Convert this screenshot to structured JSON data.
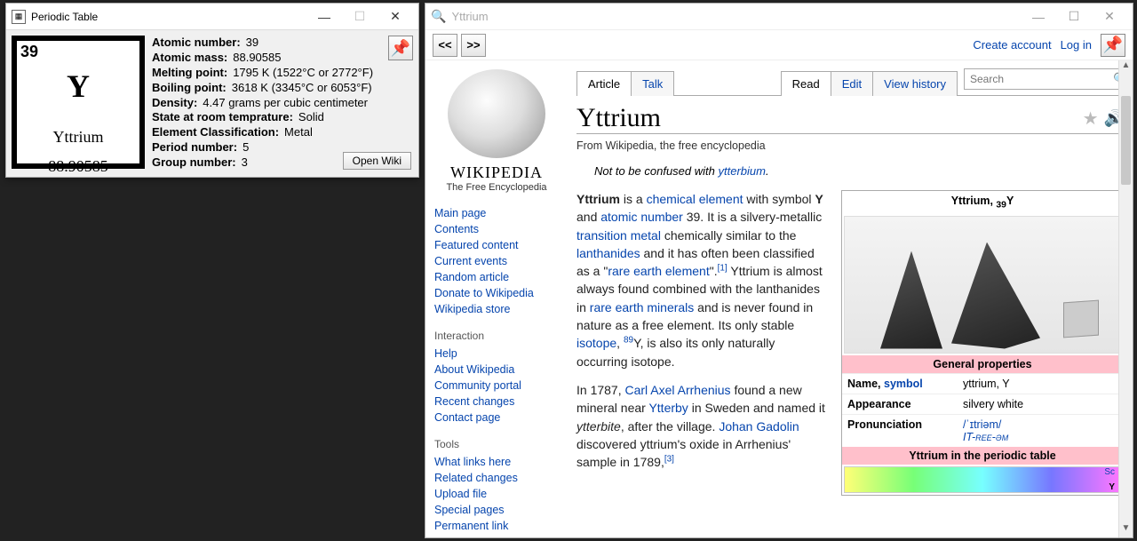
{
  "pt_window": {
    "title": "Periodic Table",
    "tile": {
      "number": "39",
      "symbol": "Y",
      "name": "Yttrium",
      "mass": "88.90585"
    },
    "props": {
      "atomic_number_label": "Atomic number:",
      "atomic_number": "39",
      "atomic_mass_label": "Atomic mass:",
      "atomic_mass": "88.90585",
      "melting_label": "Melting point:",
      "melting": "1795 K (1522°C or 2772°F)",
      "boiling_label": "Boiling point:",
      "boiling": "3618 K (3345°C or 6053°F)",
      "density_label": "Density:",
      "density": "4.47 grams per cubic centimeter",
      "state_label": "State at room temprature:",
      "state": "Solid",
      "class_label": "Element Classification:",
      "class": "Metal",
      "period_label": "Period number:",
      "period": "5",
      "group_label": "Group number:",
      "group": "3"
    },
    "open_wiki": "Open Wiki"
  },
  "wiki_window": {
    "title": "Yttrium",
    "nav_prev": "<<",
    "nav_next": ">>",
    "create_account": "Create account",
    "log_in": "Log in",
    "logo": {
      "word": "WIKIPEDIA",
      "tag": "The Free Encyclopedia"
    },
    "side_nav": {
      "main": [
        "Main page",
        "Contents",
        "Featured content",
        "Current events",
        "Random article",
        "Donate to Wikipedia",
        "Wikipedia store"
      ],
      "interaction_head": "Interaction",
      "interaction": [
        "Help",
        "About Wikipedia",
        "Community portal",
        "Recent changes",
        "Contact page"
      ],
      "tools_head": "Tools",
      "tools": [
        "What links here",
        "Related changes",
        "Upload file",
        "Special pages",
        "Permanent link"
      ]
    },
    "tabs": {
      "article": "Article",
      "talk": "Talk",
      "read": "Read",
      "edit": "Edit",
      "history": "View history"
    },
    "search_placeholder": "Search",
    "article": {
      "heading": "Yttrium",
      "sub": "From Wikipedia, the free encyclopedia",
      "note_prefix": "Not to be confused with ",
      "note_link": "ytterbium",
      "note_suffix": ".",
      "para1_parts": {
        "t1": "Yttrium",
        "t2": " is a ",
        "l1": "chemical element",
        "t3": " with symbol ",
        "b1": "Y",
        "t4": " and ",
        "l2": "atomic number",
        "t5": " 39. It is a silvery-metallic ",
        "l3": "transition metal",
        "t6": " chemically similar to the ",
        "l4": "lanthanides",
        "t7": " and it has often been classified as a \"",
        "l5": "rare earth element",
        "t8": "\".",
        "sup1": "[1]",
        "t9": " Yttrium is almost always found combined with the lanthanides in ",
        "l6": "rare earth minerals",
        "t10": " and is never found in nature as a free element. Its only stable ",
        "l7": "isotope",
        "t11": ", ",
        "sup2": "89",
        "t12": "Y, is also its only naturally occurring isotope."
      },
      "para2_parts": {
        "t1": "In 1787, ",
        "l1": "Carl Axel Arrhenius",
        "t2": " found a new mineral near ",
        "l2": "Ytterby",
        "t3": " in Sweden and named it ",
        "i1": "ytterbite",
        "t4": ", after the village. ",
        "l3": "Johan Gadolin",
        "t5": " discovered yttrium's oxide in Arrhenius' sample in 1789,",
        "sup1": "[3]"
      }
    },
    "infobox": {
      "title_pre": "Yttrium,  ",
      "title_sub": "39",
      "title_sym": "Y",
      "gen_props": "General properties",
      "name_k": "Name, ",
      "name_k_link": "symbol",
      "name_v": "yttrium, Y",
      "appear_k": "Appearance",
      "appear_v": "silvery white",
      "pron_k": "Pronunciation",
      "pron_v1": "/ˈɪtriəm/",
      "pron_v2": "IT-ree-əm",
      "pt_head_pre": "Yttrium in the ",
      "pt_head_link": "periodic table",
      "sc": "Sc",
      "y": "Y"
    }
  }
}
